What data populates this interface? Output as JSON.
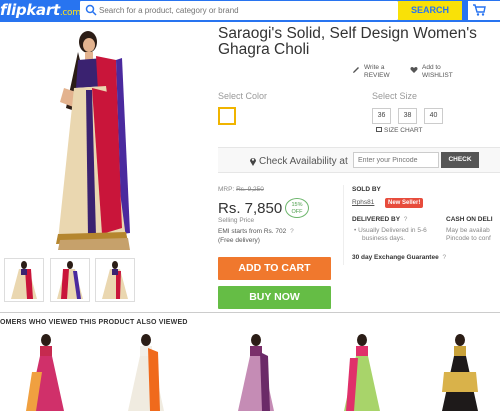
{
  "header": {
    "logo": "flipkart",
    "logo_suffix": ".com",
    "search_placeholder": "Search for a product, category or brand",
    "search_button": "SEARCH",
    "cart_icon": "cart-icon"
  },
  "product": {
    "title": "Saraogi's Solid, Self Design Women's Ghagra Choli",
    "write_review": "Write a",
    "write_review_2": "REVIEW",
    "wishlist": "Add to",
    "wishlist_2": "WISHLIST",
    "select_color": "Select Color",
    "select_size": "Select Size",
    "sizes": [
      "36",
      "38",
      "40"
    ],
    "size_chart": "SIZE CHART",
    "check_availability": "Check Availability at",
    "pincode_placeholder": "Enter your Pincode",
    "check_button": "CHECK",
    "mrp_label": "MRP:",
    "mrp_value": "Rs. 9,250",
    "price": "Rs. 7,850",
    "discount_pct": "15%",
    "discount_off": "OFF",
    "selling_price": "Selling Price",
    "emi": "EMI starts from Rs. 702",
    "emi_help": "?",
    "free_delivery": "(Free delivery)",
    "add_to_cart": "ADD TO CART",
    "buy_now": "BUY NOW"
  },
  "seller": {
    "sold_by": "SOLD BY",
    "seller_name": "Rphs81",
    "new_seller": "New Seller!",
    "delivered_by": "DELIVERED BY",
    "delivered_help": "?",
    "delivery_note": "Usually Delivered in 5-6",
    "delivery_note_2": "business days.",
    "cod": "CASH ON DELI",
    "cod_note": "May be availab",
    "cod_note_2": "Pincode to conf",
    "exchange": "30 day Exchange Guarantee",
    "exchange_help": "?"
  },
  "related": {
    "title": "OMERS WHO VIEWED THIS PRODUCT ALSO VIEWED"
  },
  "colors": {
    "brand_blue": "#2874f0",
    "search_yellow": "#f9e107",
    "add_to_cart": "#f0782d",
    "buy_now": "#65bd45",
    "new_seller": "#e74c3c"
  }
}
